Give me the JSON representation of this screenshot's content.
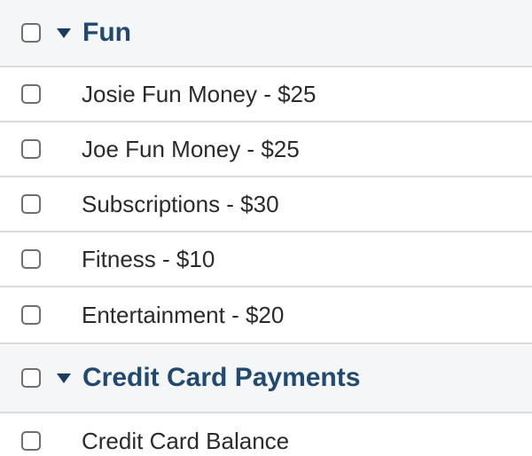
{
  "groups": [
    {
      "title": "Fun",
      "items": [
        {
          "label": "Josie Fun Money - $25"
        },
        {
          "label": "Joe Fun Money - $25"
        },
        {
          "label": "Subscriptions - $30"
        },
        {
          "label": "Fitness - $10"
        },
        {
          "label": "Entertainment - $20"
        }
      ]
    },
    {
      "title": "Credit Card Payments",
      "items": [
        {
          "label": "Credit Card Balance"
        }
      ]
    }
  ],
  "colors": {
    "group_title": "#22496f",
    "caret": "#1d3d5e",
    "header_bg": "#f5f6f8",
    "divider": "#dcdcdc",
    "checkbox_border": "#6f6f6f"
  },
  "icons": {
    "expanded": "caret-down-icon",
    "checkbox": "checkbox-unchecked-icon"
  }
}
